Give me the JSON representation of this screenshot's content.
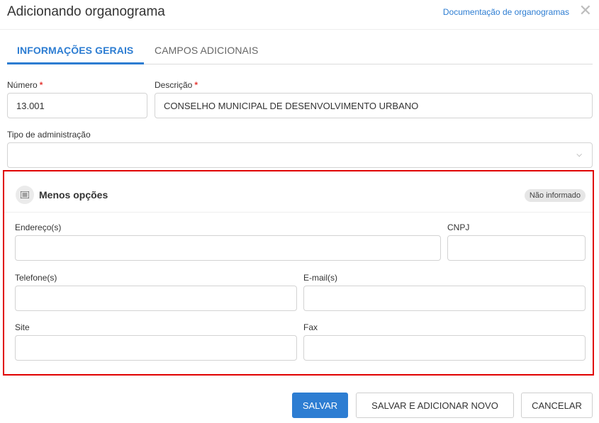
{
  "header": {
    "title": "Adicionando organograma",
    "doc_link": "Documentação de organogramas",
    "close_glyph": "✕"
  },
  "tabs": [
    {
      "label": "INFORMAÇÕES GERAIS",
      "active": true
    },
    {
      "label": "CAMPOS ADICIONAIS",
      "active": false
    }
  ],
  "form": {
    "numero": {
      "label": "Número",
      "required_mark": "*",
      "value": "13.001"
    },
    "descricao": {
      "label": "Descrição",
      "required_mark": "*",
      "value": "CONSELHO MUNICIPAL DE DESENVOLVIMENTO URBANO"
    },
    "tipo": {
      "label": "Tipo de administração",
      "value": "",
      "chevron": "⌵"
    }
  },
  "panel": {
    "title": "Menos opções",
    "icon": "list-icon",
    "badge": "Não informado",
    "fields": {
      "endereco": {
        "label": "Endereço(s)",
        "value": ""
      },
      "cnpj": {
        "label": "CNPJ",
        "value": ""
      },
      "telefone": {
        "label": "Telefone(s)",
        "value": ""
      },
      "email": {
        "label": "E-mail(s)",
        "value": ""
      },
      "site": {
        "label": "Site",
        "value": ""
      },
      "fax": {
        "label": "Fax",
        "value": ""
      }
    }
  },
  "actions": {
    "save": "SALVAR",
    "save_new": "SALVAR E ADICIONAR NOVO",
    "cancel": "CANCELAR"
  },
  "colors": {
    "accent": "#2d7dd2",
    "highlight_border": "#e00000",
    "required": "#e53935"
  }
}
